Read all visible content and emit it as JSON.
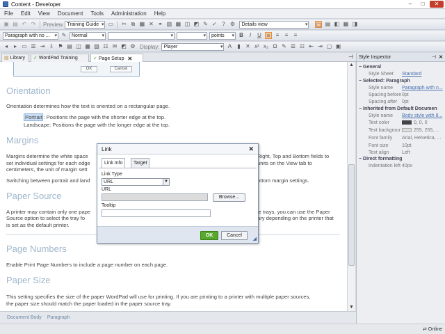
{
  "window": {
    "title": "Content - Developer",
    "minimize": "–",
    "maximize": "□",
    "close": "✕"
  },
  "menu": [
    "File",
    "Edit",
    "View",
    "Document",
    "Tools",
    "Administration",
    "Help"
  ],
  "toolbar1": {
    "preview_label": "Preview",
    "style_set": "Training Guide",
    "view_mode": "Details view"
  },
  "toolbar2": {
    "paragraph_style": "Paragraph with no ...",
    "char_style": "Normal",
    "font": "",
    "size": "",
    "units": "points"
  },
  "toolbar3": {
    "display_label": "Display:",
    "display_value": "Player"
  },
  "tabs": [
    {
      "label": "Library"
    },
    {
      "label": "WordPad Training"
    },
    {
      "label": "Page Setup"
    }
  ],
  "document": {
    "shot_ok": "OK",
    "shot_cancel": "Cancel",
    "h_orientation": "Orientation",
    "p_orientation": "Orientation determines how the text is oriented on a rectangular page.",
    "portrait_word": "Portrait",
    "portrait_rest": ": Positions the page with the shorter edge at the top.",
    "landscape": "Landscape: Positions the page with the longer edge at the top.",
    "h_margins": "Margins",
    "p_margins_1a": "Margins determine the white space",
    "p_margins_1b": "Right, Top and Bottom fields to",
    "p_margins_2a": "set individual settings for each edge",
    "p_margins_2b": "units on the View tab to",
    "p_margins_3": "centimeters, the unit of margin sett",
    "p_margins_4a": "Switching between portrait and land",
    "p_margins_4b": "ottom margin settings.",
    "h_papersource": "Paper Source",
    "p_ps_1a": "A printer may contain only one pape",
    "p_ps_1b": "le trays, you can use the Paper",
    "p_ps_2a": "Source option to select the tray fo",
    "p_ps_2b": "ary depending on the printer that",
    "p_ps_3": "is set as the default printer.",
    "h_pagenumbers": "Page Numbers",
    "p_pn": "Enable Print Page Numbers to include a page number on each page.",
    "h_papersize": "Paper Size",
    "p_size_1": "This setting specifies the size of the paper WordPad will use for printing. If you are printing to a printer with multiple paper sources,",
    "p_size_2": "the paper size should match the paper loaded in the paper source tray."
  },
  "status": [
    "Document Body",
    "Paragraph"
  ],
  "inspector": {
    "title": "Style Inspector",
    "general": "General",
    "style_sheet_label": "Style Sheet",
    "style_sheet_value": "Standard",
    "selected": "Selected: Paragraph",
    "style_name_label": "Style name",
    "style_name_value": "Paragraph with n...",
    "spacing_before_label": "Spacing before",
    "spacing_before_value": "0pt",
    "spacing_after_label": "Spacing after",
    "spacing_after_value": "0pt",
    "inherited": "Inherited from Default Documen",
    "style_name2_label": "Style name",
    "style_name2_value": "Body style with 8...",
    "text_color_label": "Text color",
    "text_color_value": "0, 0, 0",
    "text_bg_label": "Text backgrour",
    "text_bg_value": "255, 255, ...",
    "font_family_label": "Font family",
    "font_family_value": "Arial, Helvetica, ...",
    "font_size_label": "Font size",
    "font_size_value": "10pt",
    "text_align_label": "Text align",
    "text_align_value": "Left",
    "direct": "Direct formatting",
    "indent_value": "Indentation left 40px"
  },
  "bottom": {
    "online": "Online"
  },
  "dialog": {
    "title": "Link",
    "tab_linkinfo": "Link Info",
    "tab_target": "Target",
    "link_type_label": "Link Type",
    "link_type_value": "URL",
    "url_label": "URL",
    "url_value": "",
    "browse": "Browse...",
    "tooltip_label": "Tooltip",
    "tooltip_value": "",
    "ok": "OK",
    "cancel": "Cancel"
  },
  "colors": {
    "heading": "#9fb7cd",
    "ok_green": "#58a82e",
    "link": "#4a72b0"
  }
}
